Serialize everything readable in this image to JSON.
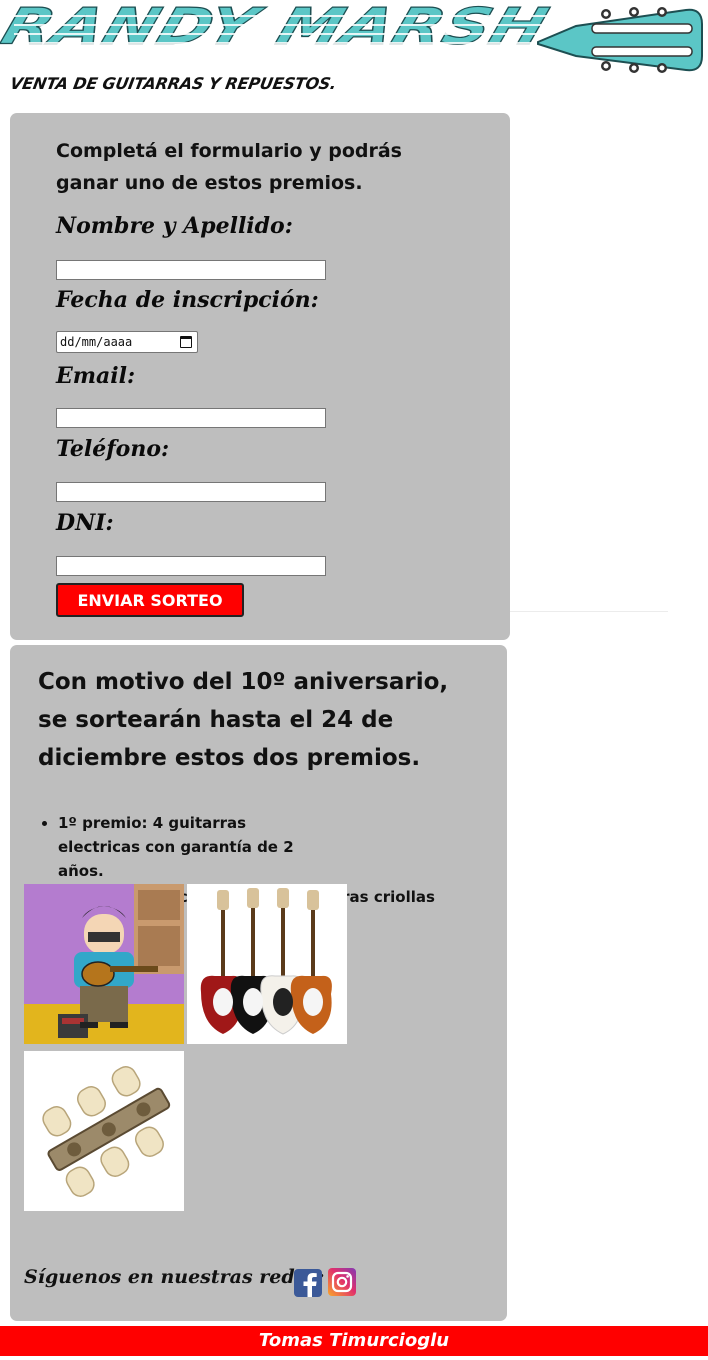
{
  "header": {
    "logo_title": "RANDY MARSH",
    "logo_subtitle": "VENTA DE GUITARRAS Y REPUESTOS.",
    "brand_color": "#5bc6c6"
  },
  "form": {
    "intro": "Completá el formulario y podrás ganar uno de estos premios.",
    "fields": [
      {
        "label": "Nombre y Apellido:",
        "value": ""
      },
      {
        "label": "Fecha de inscripción:",
        "placeholder": "dd/mm/aaaa"
      },
      {
        "label": "Email:",
        "value": ""
      },
      {
        "label": "Teléfono:",
        "value": ""
      },
      {
        "label": "DNI:",
        "value": ""
      }
    ],
    "submit_label": "ENVIAR SORTEO",
    "submit_color": "#ff0000"
  },
  "promo": {
    "heading": "Con motivo del 10º aniversario, se sortearán hasta el 24 de diciembre estos dos premios.",
    "prizes": [
      "1º premio: 4 guitarras electricas con garantía de 2 años.",
      "2º premio: 10 clavijas para guitarras criollas"
    ],
    "images": [
      "randy-guitar-image",
      "electric-guitars-image",
      "tuning-pegs-image"
    ],
    "social_label": "Síguenos en nuestras redes:",
    "social_icons": [
      "facebook-icon",
      "instagram-icon"
    ]
  },
  "footer": {
    "author": "Tomas Timurcioglu"
  },
  "colors": {
    "panel": "#bebebe",
    "footer": "#ff0000"
  }
}
